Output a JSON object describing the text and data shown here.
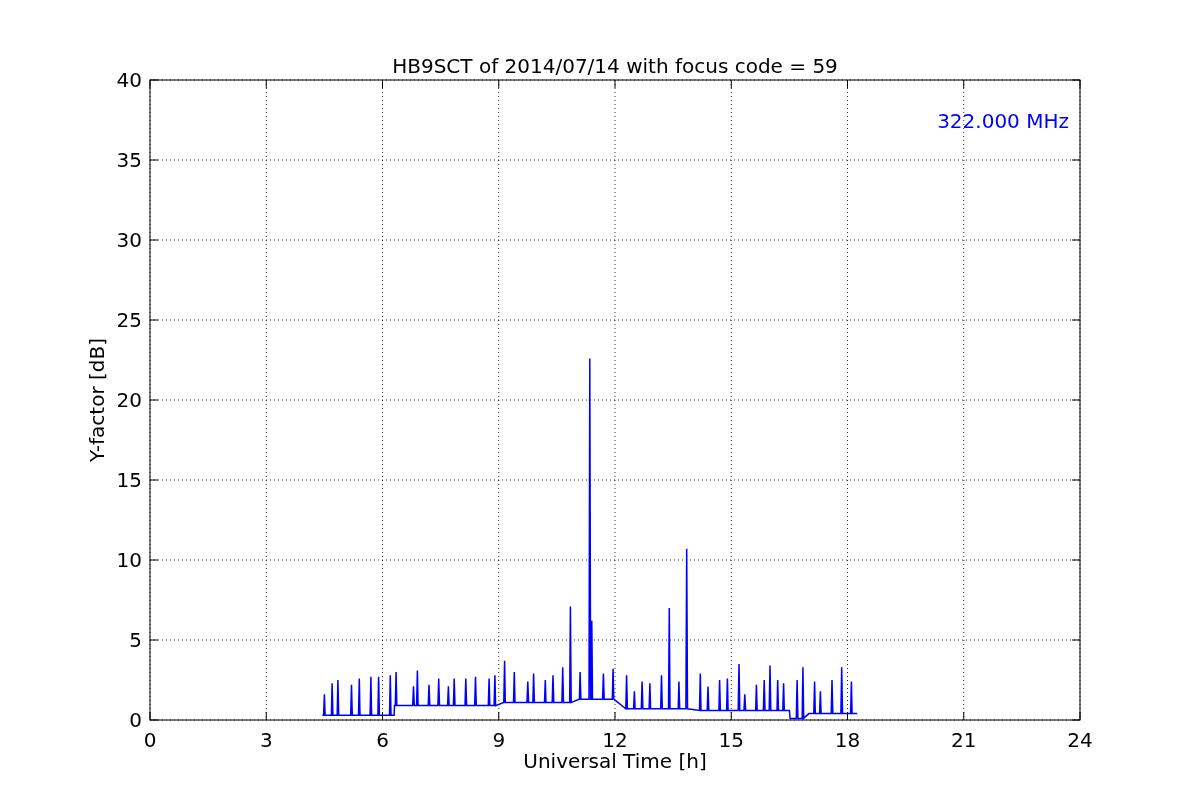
{
  "figure": {
    "chart_data": {
      "type": "line",
      "title": "HB9SCT of 2014/07/14 with focus code = 59",
      "xlabel": "Universal Time [h]",
      "ylabel": "Y-factor [dB]",
      "xlim": [
        0,
        24
      ],
      "ylim": [
        0,
        40
      ],
      "xticks": [
        0,
        3,
        6,
        9,
        12,
        15,
        18,
        21,
        24
      ],
      "yticks": [
        0,
        5,
        10,
        15,
        20,
        25,
        30,
        35,
        40
      ],
      "x": [
        4.45,
        4.48,
        4.5,
        4.52,
        4.68,
        4.7,
        4.72,
        4.83,
        4.85,
        4.87,
        5.18,
        5.2,
        5.22,
        5.38,
        5.4,
        5.42,
        5.68,
        5.7,
        5.72,
        5.88,
        5.9,
        5.92,
        6.18,
        6.2,
        6.22,
        6.3,
        6.31,
        6.33,
        6.35,
        6.37,
        6.78,
        6.8,
        6.82,
        6.88,
        6.9,
        6.92,
        7.18,
        7.2,
        7.22,
        7.43,
        7.45,
        7.47,
        7.68,
        7.7,
        7.72,
        7.83,
        7.85,
        7.87,
        8.13,
        8.15,
        8.17,
        8.38,
        8.4,
        8.42,
        8.73,
        8.75,
        8.77,
        8.88,
        8.9,
        8.92,
        9.13,
        9.15,
        9.17,
        9.38,
        9.4,
        9.42,
        9.73,
        9.75,
        9.77,
        9.88,
        9.9,
        9.92,
        10.18,
        10.2,
        10.22,
        10.38,
        10.4,
        10.42,
        10.63,
        10.65,
        10.67,
        10.83,
        10.85,
        10.87,
        11.08,
        11.1,
        11.12,
        11.33,
        11.35,
        11.37,
        11.39,
        11.4,
        11.42,
        11.68,
        11.7,
        11.72,
        11.93,
        11.95,
        11.97,
        12.28,
        12.3,
        12.32,
        12.48,
        12.5,
        12.52,
        12.68,
        12.7,
        12.72,
        12.88,
        12.9,
        12.92,
        13.18,
        13.2,
        13.22,
        13.38,
        13.4,
        13.42,
        13.63,
        13.65,
        13.67,
        13.83,
        13.85,
        13.87,
        14.18,
        14.2,
        14.22,
        14.38,
        14.4,
        14.42,
        14.68,
        14.7,
        14.72,
        14.88,
        14.9,
        14.92,
        15.18,
        15.2,
        15.22,
        15.33,
        15.35,
        15.37,
        15.63,
        15.65,
        15.67,
        15.83,
        15.85,
        15.87,
        15.98,
        16.0,
        16.02,
        16.18,
        16.2,
        16.22,
        16.33,
        16.35,
        16.37,
        16.5,
        16.52,
        16.68,
        16.7,
        16.72,
        16.83,
        16.85,
        16.87,
        17.0,
        17.13,
        17.15,
        17.17,
        17.28,
        17.3,
        17.32,
        17.58,
        17.6,
        17.62,
        17.83,
        17.85,
        17.87,
        18.08,
        18.1,
        18.12,
        18.25
      ],
      "series": [
        {
          "name": "322.000 MHz",
          "color": "#0000ff",
          "values": [
            0.3,
            0.3,
            1.6,
            0.3,
            0.3,
            2.3,
            0.3,
            0.3,
            2.5,
            0.3,
            0.3,
            2.2,
            0.3,
            0.3,
            2.6,
            0.3,
            0.3,
            2.7,
            0.3,
            0.3,
            2.7,
            0.3,
            0.3,
            2.8,
            0.3,
            0.3,
            0.9,
            0.9,
            3.0,
            0.9,
            0.9,
            2.1,
            0.9,
            0.9,
            3.1,
            0.9,
            0.9,
            2.2,
            0.9,
            0.9,
            2.6,
            0.9,
            0.9,
            2.1,
            0.9,
            0.9,
            2.6,
            0.9,
            0.9,
            2.6,
            0.9,
            0.9,
            2.7,
            0.9,
            0.9,
            2.6,
            0.9,
            0.9,
            2.8,
            0.9,
            1.1,
            3.7,
            1.1,
            1.1,
            3.0,
            1.1,
            1.1,
            2.4,
            1.1,
            1.1,
            2.9,
            1.1,
            1.1,
            2.5,
            1.1,
            1.1,
            2.8,
            1.1,
            1.1,
            3.3,
            1.1,
            1.1,
            7.1,
            1.1,
            1.3,
            3.0,
            1.3,
            1.3,
            22.6,
            1.3,
            1.3,
            6.2,
            1.3,
            1.3,
            2.9,
            1.3,
            1.3,
            3.2,
            1.3,
            0.7,
            2.8,
            0.7,
            0.7,
            1.8,
            0.7,
            0.7,
            2.4,
            0.7,
            0.7,
            2.3,
            0.7,
            0.7,
            2.8,
            0.7,
            0.7,
            7.0,
            0.7,
            0.7,
            2.4,
            0.7,
            0.7,
            10.7,
            0.7,
            0.6,
            2.9,
            0.6,
            0.6,
            2.1,
            0.6,
            0.6,
            2.5,
            0.6,
            0.6,
            2.6,
            0.6,
            0.6,
            3.5,
            0.6,
            0.6,
            1.6,
            0.6,
            0.6,
            2.2,
            0.6,
            0.6,
            2.5,
            0.6,
            0.6,
            3.4,
            0.6,
            0.6,
            2.5,
            0.6,
            0.6,
            2.3,
            0.6,
            0.6,
            0.1,
            0.1,
            2.5,
            0.1,
            0.1,
            3.3,
            0.1,
            0.4,
            0.4,
            2.4,
            0.4,
            0.4,
            1.8,
            0.4,
            0.4,
            2.5,
            0.4,
            0.4,
            3.3,
            0.4,
            0.4,
            2.4,
            0.4,
            0.4
          ]
        }
      ],
      "grid": true
    }
  }
}
